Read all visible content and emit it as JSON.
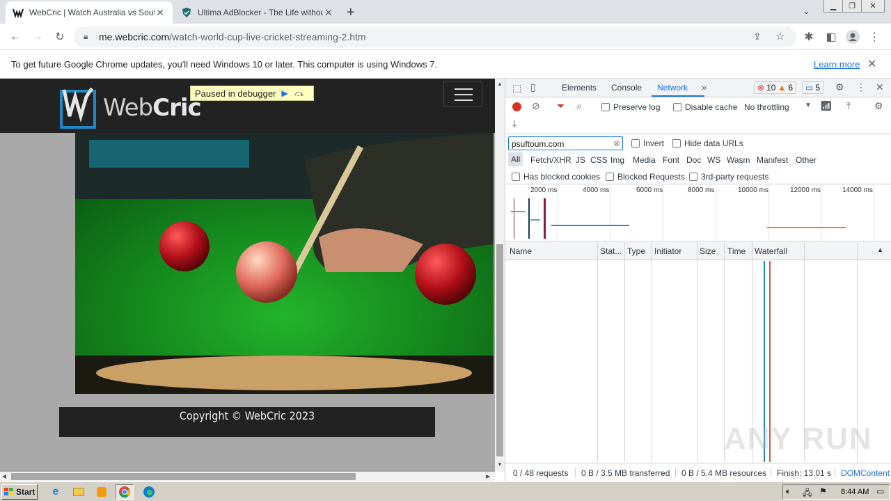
{
  "browser": {
    "tabs": [
      {
        "title": "WebCric | Watch Australia vs South",
        "active": true
      },
      {
        "title": "Ultima AdBlocker - The Life without A",
        "active": false
      }
    ],
    "url_host": "me.webcric.com",
    "url_path": "/watch-world-cup-live-cricket-streaming-2.htm"
  },
  "infobar": {
    "message": "To get future Google Chrome updates, you'll need Windows 10 or later. This computer is using Windows 7.",
    "learn_more": "Learn more"
  },
  "page": {
    "logo_text_a": "Web",
    "logo_text_b": "Cric",
    "debugger_label": "Paused in debugger",
    "footer": "Copyright © WebCric 2023"
  },
  "devtools": {
    "tabs": [
      "Elements",
      "Console",
      "Network"
    ],
    "active_tab": "Network",
    "errors": "10",
    "warnings": "6",
    "messages": "5",
    "preserve_log": "Preserve log",
    "disable_cache": "Disable cache",
    "throttling": "No throttling",
    "filter_value": "psuftoum.com",
    "invert": "Invert",
    "hide_data_urls": "Hide data URLs",
    "types": [
      "All",
      "Fetch/XHR",
      "JS",
      "CSS",
      "Img",
      "Media",
      "Font",
      "Doc",
      "WS",
      "Wasm",
      "Manifest",
      "Other"
    ],
    "has_blocked_cookies": "Has blocked cookies",
    "blocked_requests": "Blocked Requests",
    "third_party": "3rd-party requests",
    "ticks": [
      "2000 ms",
      "4000 ms",
      "6000 ms",
      "8000 ms",
      "10000 ms",
      "12000 ms",
      "14000 ms"
    ],
    "columns": [
      "Name",
      "Stat...",
      "Type",
      "Initiator",
      "Size",
      "Time",
      "Waterfall"
    ],
    "status": {
      "requests": "0 / 48 requests",
      "transferred": "0 B / 3.5 MB transferred",
      "resources": "0 B / 5.4 MB resources",
      "finish": "Finish: 13.01 s",
      "domcontent": "DOMContent"
    }
  },
  "taskbar": {
    "start": "Start",
    "clock": "8:44 AM"
  },
  "watermark": "ANY RUN"
}
